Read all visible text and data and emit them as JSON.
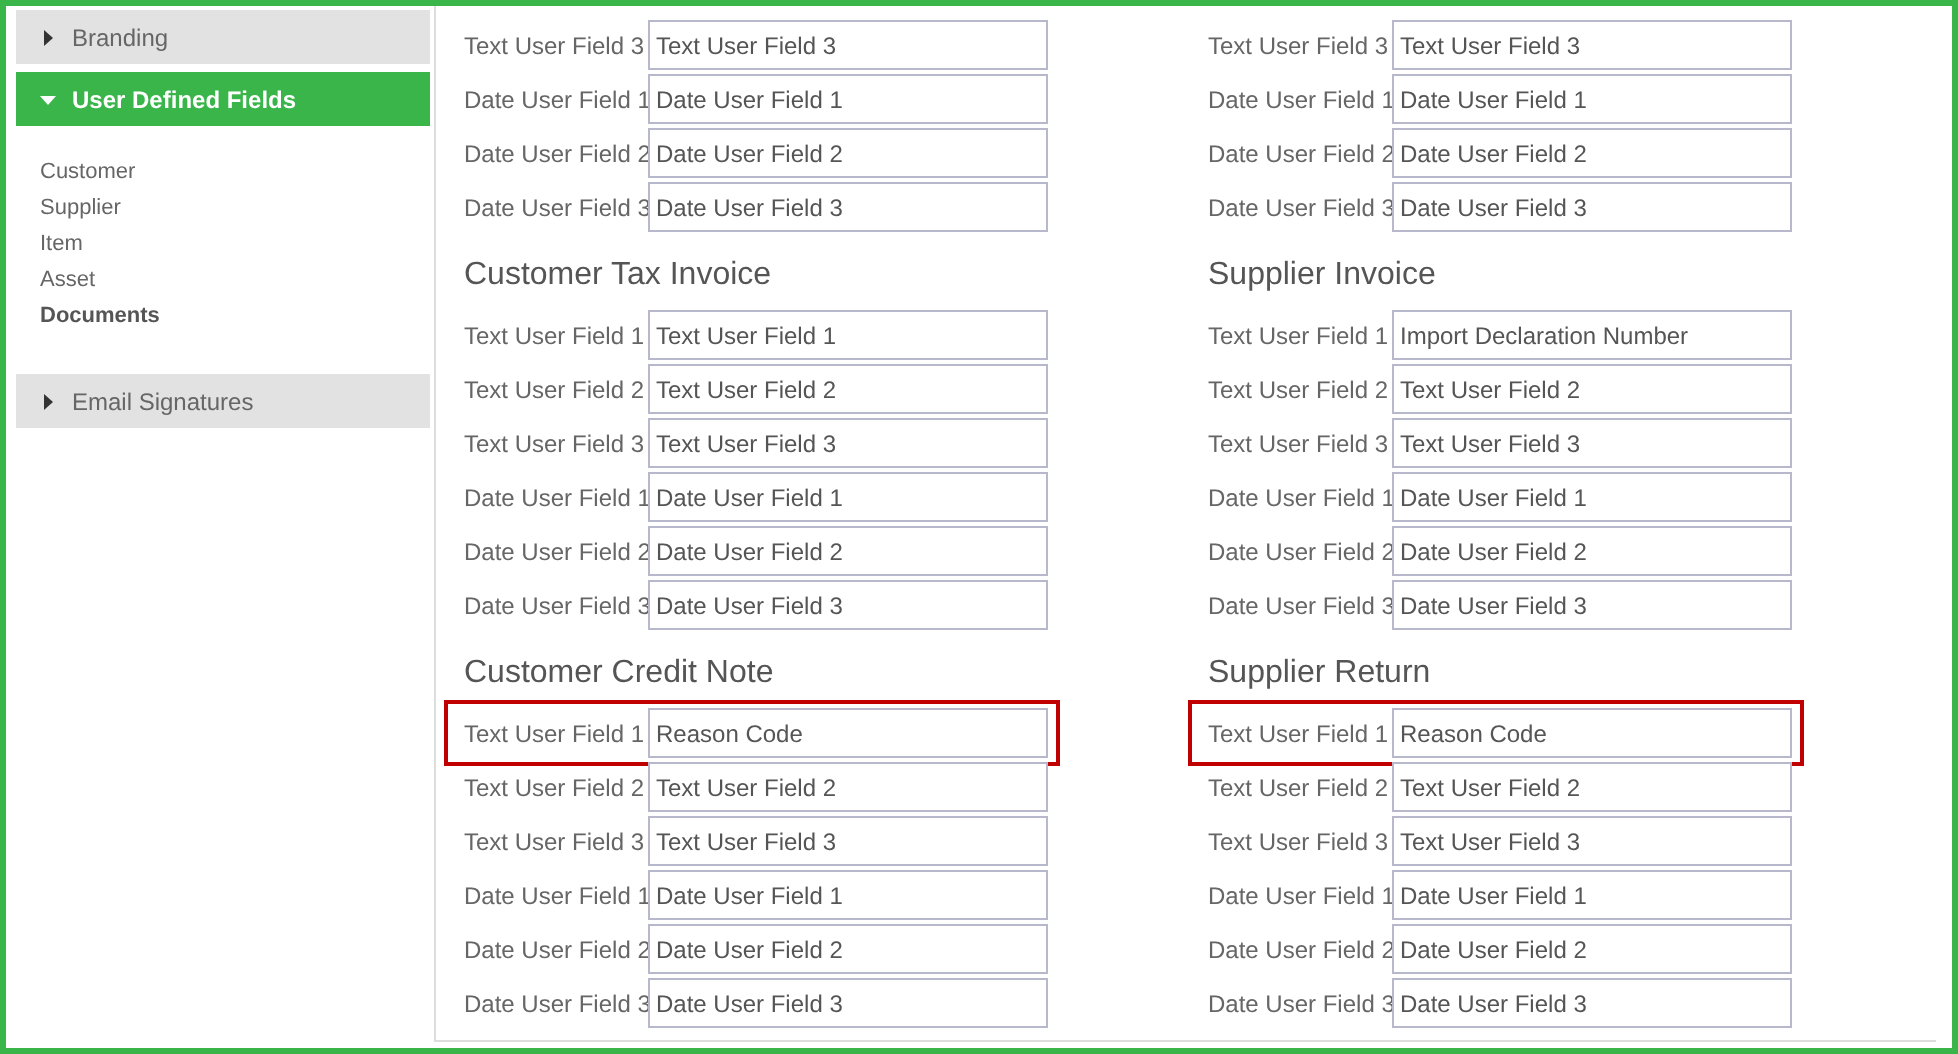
{
  "sidebar": {
    "sections": [
      {
        "title": "Branding",
        "expanded": false
      },
      {
        "title": "User Defined Fields",
        "expanded": true,
        "items": [
          {
            "label": "Customer",
            "selected": false
          },
          {
            "label": "Supplier",
            "selected": false
          },
          {
            "label": "Item",
            "selected": false
          },
          {
            "label": "Asset",
            "selected": false
          },
          {
            "label": "Documents",
            "selected": true
          }
        ]
      },
      {
        "title": "Email Signatures",
        "expanded": false
      }
    ]
  },
  "columns": [
    {
      "groups": [
        {
          "rows": [
            {
              "label": "Text User Field 3",
              "value": "Text User Field 3",
              "highlighted": false
            },
            {
              "label": "Date User Field 1",
              "value": "Date User Field 1",
              "highlighted": false
            },
            {
              "label": "Date User Field 2",
              "value": "Date User Field 2",
              "highlighted": false
            },
            {
              "label": "Date User Field 3",
              "value": "Date User Field 3",
              "highlighted": false
            }
          ]
        },
        {
          "title": "Customer Tax Invoice",
          "rows": [
            {
              "label": "Text User Field 1",
              "value": "Text User Field 1",
              "highlighted": false
            },
            {
              "label": "Text User Field 2",
              "value": "Text User Field 2",
              "highlighted": false
            },
            {
              "label": "Text User Field 3",
              "value": "Text User Field 3",
              "highlighted": false
            },
            {
              "label": "Date User Field 1",
              "value": "Date User Field 1",
              "highlighted": false
            },
            {
              "label": "Date User Field 2",
              "value": "Date User Field 2",
              "highlighted": false
            },
            {
              "label": "Date User Field 3",
              "value": "Date User Field 3",
              "highlighted": false
            }
          ]
        },
        {
          "title": "Customer Credit Note",
          "rows": [
            {
              "label": "Text User Field 1",
              "value": "Reason Code",
              "highlighted": true
            },
            {
              "label": "Text User Field 2",
              "value": "Text User Field 2",
              "highlighted": false
            },
            {
              "label": "Text User Field 3",
              "value": "Text User Field 3",
              "highlighted": false
            },
            {
              "label": "Date User Field 1",
              "value": "Date User Field 1",
              "highlighted": false
            },
            {
              "label": "Date User Field 2",
              "value": "Date User Field 2",
              "highlighted": false
            },
            {
              "label": "Date User Field 3",
              "value": "Date User Field 3",
              "highlighted": false
            }
          ]
        }
      ]
    },
    {
      "groups": [
        {
          "rows": [
            {
              "label": "Text User Field 3",
              "value": "Text User Field 3",
              "highlighted": false
            },
            {
              "label": "Date User Field 1",
              "value": "Date User Field 1",
              "highlighted": false
            },
            {
              "label": "Date User Field 2",
              "value": "Date User Field 2",
              "highlighted": false
            },
            {
              "label": "Date User Field 3",
              "value": "Date User Field 3",
              "highlighted": false
            }
          ]
        },
        {
          "title": "Supplier Invoice",
          "rows": [
            {
              "label": "Text User Field 1",
              "value": "Import Declaration Number",
              "highlighted": false
            },
            {
              "label": "Text User Field 2",
              "value": "Text User Field 2",
              "highlighted": false
            },
            {
              "label": "Text User Field 3",
              "value": "Text User Field 3",
              "highlighted": false
            },
            {
              "label": "Date User Field 1",
              "value": "Date User Field 1",
              "highlighted": false
            },
            {
              "label": "Date User Field 2",
              "value": "Date User Field 2",
              "highlighted": false
            },
            {
              "label": "Date User Field 3",
              "value": "Date User Field 3",
              "highlighted": false
            }
          ]
        },
        {
          "title": "Supplier Return",
          "rows": [
            {
              "label": "Text User Field 1",
              "value": "Reason Code",
              "highlighted": true
            },
            {
              "label": "Text User Field 2",
              "value": "Text User Field 2",
              "highlighted": false
            },
            {
              "label": "Text User Field 3",
              "value": "Text User Field 3",
              "highlighted": false
            },
            {
              "label": "Date User Field 1",
              "value": "Date User Field 1",
              "highlighted": false
            },
            {
              "label": "Date User Field 2",
              "value": "Date User Field 2",
              "highlighted": false
            },
            {
              "label": "Date User Field 3",
              "value": "Date User Field 3",
              "highlighted": false
            }
          ]
        }
      ]
    }
  ]
}
